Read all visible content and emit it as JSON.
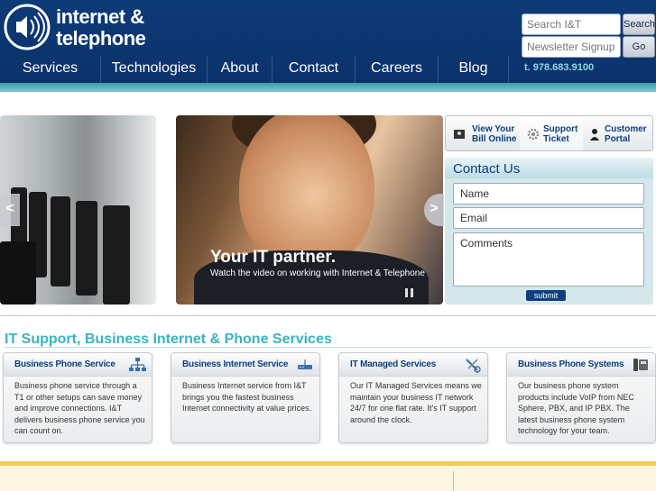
{
  "brand": {
    "line1": "internet &",
    "line2": "telephone"
  },
  "header": {
    "search_placeholder": "Search I&T",
    "search_button": "Search",
    "newsletter_placeholder": "Newsletter Signup",
    "newsletter_button": "Go",
    "phone": "t. 978.683.9100"
  },
  "nav": [
    "Services",
    "Technologies",
    "About",
    "Contact",
    "Careers",
    "Blog"
  ],
  "hero": {
    "title": "Your IT partner.",
    "subtitle": "Watch the video on working with Internet & Telephone",
    "prev_label": "<",
    "next_label": ">"
  },
  "quick_links": [
    {
      "line1": "View Your",
      "line2": "Bill Online",
      "icon": "bill-icon"
    },
    {
      "line1": "Support",
      "line2": "Ticket",
      "icon": "gear-icon"
    },
    {
      "line1": "Customer",
      "line2": "Portal",
      "icon": "person-icon"
    }
  ],
  "contact": {
    "title": "Contact Us",
    "name_placeholder": "Name",
    "email_placeholder": "Email",
    "comments_placeholder": "Comments",
    "submit": "submit"
  },
  "section": {
    "title": "IT Support, Business Internet & Phone Services"
  },
  "cards": [
    {
      "title": "Business Phone Service",
      "icon": "network-icon",
      "body": "Business phone service through a T1 or other setups can save money and improve connections. I&T delivers business phone service you can count on."
    },
    {
      "title": "Business Internet Service",
      "icon": "router-icon",
      "body": "Business Internet service from I&T brings you the fastest business Internet connectivity at value prices."
    },
    {
      "title": "IT Managed Services",
      "icon": "tools-icon",
      "body": "Our IT Managed Services means we maintain your business IT network 24/7 for one flat rate. It's IT support around the clock."
    },
    {
      "title": "Business Phone Systems",
      "icon": "phone-system-icon",
      "body": "Our business phone system products include VoIP from NEC Sphere, PBX, and IP PBX. The latest business phone system technology for your team."
    }
  ]
}
